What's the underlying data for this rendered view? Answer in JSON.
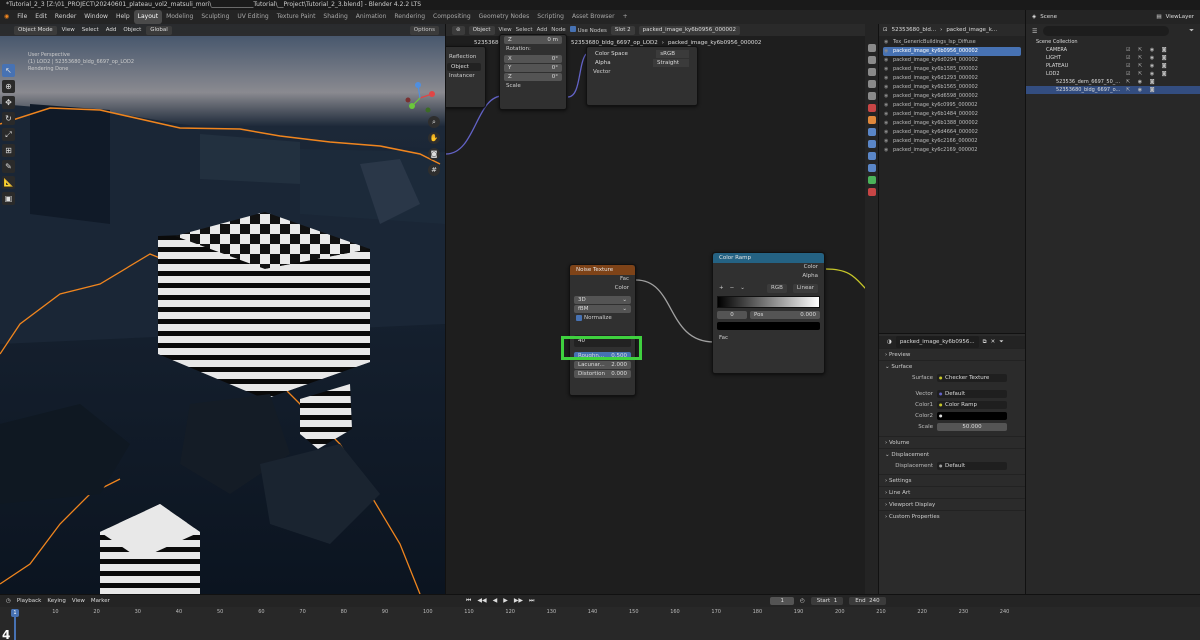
{
  "window": {
    "title": "*Tutorial_2_3 [Z:\\01_PROJECT\\20240601_plateau_vol2_matsuli_mori\\______________Tutorial\\__Project\\Tutorial_2_3.blend] - Blender 4.2.2 LTS"
  },
  "menu": [
    "File",
    "Edit",
    "Render",
    "Window",
    "Help"
  ],
  "workspaces": [
    "Layout",
    "Modeling",
    "Sculpting",
    "UV Editing",
    "Texture Paint",
    "Shading",
    "Animation",
    "Rendering",
    "Compositing",
    "Geometry Nodes",
    "Scripting",
    "Asset Browser"
  ],
  "active_workspace": "Layout",
  "scene": {
    "name": "Scene",
    "view_layer": "ViewLayer"
  },
  "viewport": {
    "mode": "Object Mode",
    "menu": [
      "View",
      "Select",
      "Add",
      "Object"
    ],
    "transform": "Global",
    "options": "Options",
    "info": [
      "User Perspective",
      "(1) LOD2 | 52353680_bldg_6697_op_LOD2",
      "Rendering Done"
    ]
  },
  "node_editor": {
    "type": "Object",
    "menu": [
      "View",
      "Select",
      "Add",
      "Node"
    ],
    "use_nodes": "Use Nodes",
    "slot": "Slot 2",
    "image": "packed_image_ky6b0956_000002",
    "breadcrumb": [
      "52353680_bldg_6697_op_LOD2",
      "52353680_bldg_6697_op_LOD2",
      "packed_image_ky6b0956_000002"
    ],
    "mapping_node": {
      "rows": [
        "Z",
        "Rotation:",
        "X",
        "Y",
        "Z",
        "Scale"
      ],
      "values": [
        "0 m",
        "0°",
        "0°",
        "0°"
      ]
    },
    "image_node": {
      "color_space_label": "Color Space",
      "color_space": "sRGB",
      "alpha_label": "Alpha",
      "alpha": "Straight",
      "vector": "Vector"
    },
    "texcoord_node": {
      "rows": [
        "Reflection",
        "Object",
        "Instancer"
      ]
    },
    "noise": {
      "title": "Noise Texture",
      "outputs": [
        "Fac",
        "Color"
      ],
      "dimensions": "3D",
      "type": "fBM",
      "normalize": "Normalize",
      "scale_input": "40",
      "roughness_label": "Roughn...",
      "roughness": "0.500",
      "lacunarity_label": "Lacunar...",
      "lacunarity": "2.000",
      "distortion_label": "Distortion",
      "distortion": "0.000"
    },
    "color_ramp": {
      "title": "Color Ramp",
      "outputs": [
        "Color",
        "Alpha"
      ],
      "mode": "RGB",
      "interpolation": "Linear",
      "index": "0",
      "pos_label": "Pos",
      "pos": "0.000",
      "input": "Fac"
    }
  },
  "properties": {
    "header": [
      "52353680_bld...",
      "packed_image_k..."
    ],
    "images": [
      "Tex_GenericBuildings_Isp_Diffuse",
      "packed_image_ky6b0956_000002",
      "packed_image_ky6d0294_000002",
      "packed_image_ky6b1585_000002",
      "packed_image_ky6d1293_000002",
      "packed_image_ky6b1565_000002",
      "packed_image_ky6d6598_000002",
      "packed_image_ky6c0995_000002",
      "packed_image_ky6b1484_000002",
      "packed_image_ky6b1388_000002",
      "packed_image_ky6d4664_000002",
      "packed_image_ky6c2166_000002",
      "packed_image_ky6c2169_000002"
    ],
    "material": "packed_image_ky6b0956...",
    "sections": [
      "Preview",
      "Surface",
      "Volume",
      "Displacement",
      "Settings",
      "Line Art",
      "Viewport Display",
      "Custom Properties"
    ],
    "surface": [
      {
        "label": "Surface",
        "value": "Checker Texture"
      },
      {
        "label": "Vector",
        "value": "Default"
      },
      {
        "label": "Color1",
        "value": "Color Ramp"
      },
      {
        "label": "Color2",
        "value": ""
      },
      {
        "label": "Scale",
        "value": "50.000"
      }
    ],
    "displacement": {
      "label": "Displacement",
      "value": "Default"
    }
  },
  "outliner": {
    "header": "Scene Collection",
    "rows": [
      {
        "name": "CAMERA",
        "indent": 1
      },
      {
        "name": "LIGHT",
        "indent": 1
      },
      {
        "name": "PLATEAU",
        "indent": 1
      },
      {
        "name": "LOD2",
        "indent": 1
      },
      {
        "name": "523536_dem_6697_50_...",
        "indent": 2
      },
      {
        "name": "52353680_bldg_6697_o...",
        "indent": 2,
        "selected": true
      }
    ]
  },
  "timeline": {
    "menu": [
      "Playback",
      "Keying",
      "View",
      "Marker"
    ],
    "current_frame": "1",
    "start_label": "Start",
    "start": "1",
    "end_label": "End",
    "end": "240",
    "ticks": [
      "0",
      "10",
      "20",
      "30",
      "40",
      "50",
      "60",
      "70",
      "80",
      "90",
      "100",
      "110",
      "120",
      "130",
      "140",
      "150",
      "160",
      "170",
      "180",
      "190",
      "200",
      "210",
      "220",
      "230",
      "240"
    ],
    "big_frame": "4"
  },
  "colors": {
    "accent": "#4772b3",
    "highlight": "#3fd13f",
    "selection_outline": "#f0851e"
  }
}
